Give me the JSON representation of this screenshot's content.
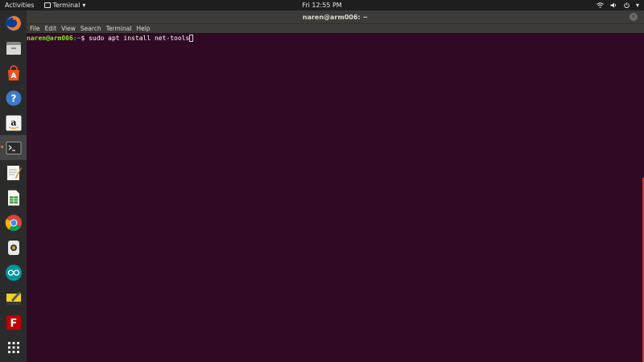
{
  "topbar": {
    "activities": "Activities",
    "app_name": "Terminal",
    "app_menu_arrow": "▾",
    "clock": "Fri 12:55 PM",
    "tray": {
      "network_icon": "wifi-icon",
      "volume_icon": "speaker-icon",
      "power_icon": "power-icon",
      "menu_arrow": "▾"
    }
  },
  "dock": {
    "items": [
      {
        "name": "firefox-icon"
      },
      {
        "name": "files-icon"
      },
      {
        "name": "software-center-icon"
      },
      {
        "name": "help-icon"
      },
      {
        "name": "amazon-icon"
      },
      {
        "name": "terminal-icon",
        "active": true
      },
      {
        "name": "text-editor-icon"
      },
      {
        "name": "spreadsheet-icon"
      },
      {
        "name": "chrome-icon"
      },
      {
        "name": "device-app-icon"
      },
      {
        "name": "arduino-icon"
      },
      {
        "name": "notes-icon"
      },
      {
        "name": "filezilla-icon"
      },
      {
        "name": "show-applications-icon"
      }
    ]
  },
  "window": {
    "title": "naren@arm006: ~",
    "close_label": "×",
    "menu": [
      "File",
      "Edit",
      "View",
      "Search",
      "Terminal",
      "Help"
    ]
  },
  "terminal": {
    "prompt_user": "naren@arm006",
    "prompt_path": ":~",
    "prompt_symbol": "$ ",
    "command": "sudo apt install net-tools"
  },
  "colors": {
    "terminal_bg": "#300a24",
    "prompt_user": "#8ae234",
    "prompt_path": "#729fcf",
    "titlebar": "#3c3b37",
    "accent": "#e95420"
  }
}
